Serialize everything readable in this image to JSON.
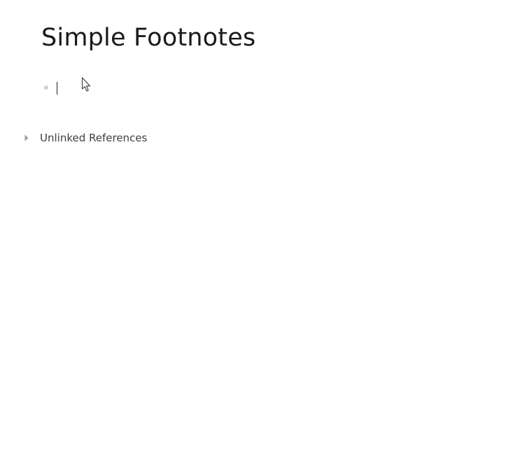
{
  "page": {
    "title": "Simple Footnotes"
  },
  "blocks": [
    {
      "text": ""
    }
  ],
  "references": {
    "label": "Unlinked References",
    "expanded": false
  },
  "icons": {
    "bullet": "bullet-dot-icon",
    "toggle": "caret-right-icon",
    "cursor": "mouse-pointer-icon"
  },
  "colors": {
    "title": "#1a1a1a",
    "bullet": "#cfd1d4",
    "refs_label": "#3d3f42",
    "toggle": "#9a9ca0"
  }
}
